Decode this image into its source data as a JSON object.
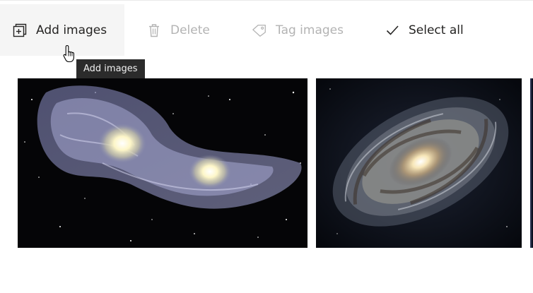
{
  "toolbar": {
    "add_label": "Add images",
    "delete_label": "Delete",
    "tag_label": "Tag images",
    "select_all_label": "Select all",
    "icons": {
      "add": "add-image-icon",
      "delete": "trash-icon",
      "tag": "tag-icon",
      "select_all": "checkmark-icon"
    }
  },
  "tooltip": {
    "text": "Add images"
  },
  "gallery": {
    "images": [
      {
        "name": "galaxy-collision-thumbnail"
      },
      {
        "name": "spiral-galaxy-thumbnail"
      },
      {
        "name": "partial-thumbnail"
      }
    ]
  },
  "colors": {
    "text_enabled": "#252423",
    "text_disabled": "#b3b3b3",
    "hover_bg": "#f5f5f5",
    "tooltip_bg": "#2b2b2b"
  }
}
